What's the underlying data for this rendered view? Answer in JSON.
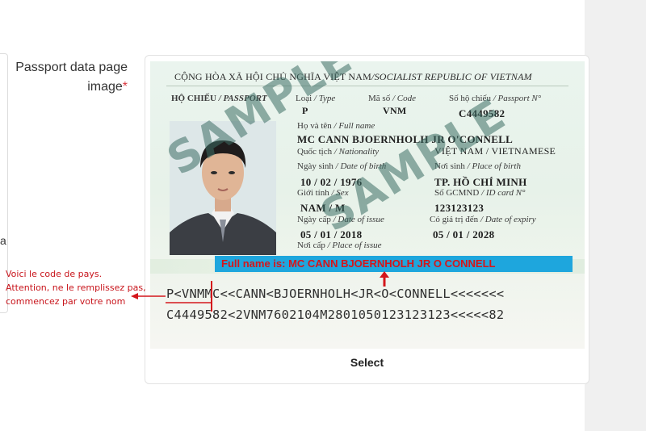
{
  "form": {
    "label_text": "Passport data page image",
    "required_mark": "*",
    "select_label": "Select"
  },
  "left_edge_glyph": "a",
  "passport": {
    "header_vn": "CỘNG HÒA XÃ HỘI CHỦ NGHĨA VIỆT NAM",
    "header_en": "/SOCIALIST REPUBLIC OF VIETNAM",
    "doc_label_vn": "HỘ CHIẾU",
    "doc_label_en": " / PASSPORT",
    "type_label_vn": "Loại",
    "type_label_en": " / Type",
    "type_value": "P",
    "code_label_vn": "Mã số",
    "code_label_en": " / Code",
    "code_value": "VNM",
    "number_label_vn": "Số hộ chiếu",
    "number_label_en": " / Passport N°",
    "number_value": "C4449582",
    "name_label_vn": "Họ và tên",
    "name_label_en": " / Full name",
    "name_value": "MC CANN BJOERNHOLH JR O'CONNELL",
    "nationality_label_vn": "Quốc tịch",
    "nationality_label_en": " / Nationality",
    "nationality_value": "VIỆT NAM / VIETNAMESE",
    "dob_label_vn": "Ngày sinh",
    "dob_label_en": " / Date of birth",
    "dob_value": "10 / 02 / 1976",
    "pob_label_vn": "Nơi sinh",
    "pob_label_en": " / Place of birth",
    "pob_value": "TP. HỒ CHÍ MINH",
    "sex_label_vn": "Giới tính",
    "sex_label_en": " / Sex",
    "sex_value": "NAM / M",
    "id_label_vn": "Số GCMND",
    "id_label_en": " / ID card N°",
    "id_value": "123123123",
    "issue_label_vn": "Ngày cấp",
    "issue_label_en": " / Date of issue",
    "issue_value": "05 / 01 / 2018",
    "expiry_label_vn": "Có giá trị đến",
    "expiry_label_en": " / Date of expiry",
    "expiry_value": "05 / 01 / 2028",
    "place_issue_label_vn": "Nơi cấp",
    "place_issue_label_en": " / Place of issue",
    "watermark_1": "SAMPLE",
    "watermark_2": "SAMPLE",
    "mrz_line1": "P<VNMMC<<CANN<BJOERNHOLH<JR<O<CONNELL<<<<<<<",
    "mrz_line2": "C4449582<2VNM7602104M2801050123123123<<<<<82"
  },
  "fullname_banner": "Full name is: MC CANN BJOERNHOLH JR O CONNELL",
  "annotation": {
    "line1": "Voici le code de pays.",
    "line2": "Attention, ne le remplissez pas,",
    "line3": "commencez par votre nom"
  },
  "colors": {
    "annotation_red": "#c8141b",
    "banner_blue": "#1ea6dd",
    "required_red": "#d9363e",
    "right_panel_gray": "#f0f0f0"
  }
}
